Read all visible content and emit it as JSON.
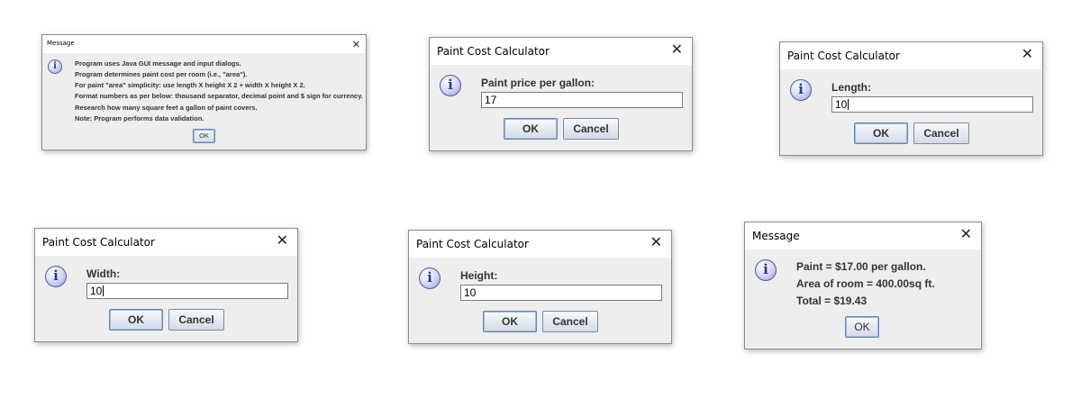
{
  "dialogs": {
    "intro": {
      "title": "Message",
      "close_glyph": "✕",
      "lines": [
        "Program uses Java GUI message and input dialogs.",
        "Program determines paint cost per room (i.e., \"area\").",
        "For paint \"area\" simplicity: use length X height X 2 + width X height X 2.",
        "Format numbers as per below: thousand separator, decimal point and $ sign for currency.",
        "Research how many square feet a gallon of paint covers.",
        "Note: Program performs data validation."
      ],
      "ok_label": "OK"
    },
    "price": {
      "title": "Paint Cost Calculator",
      "close_glyph": "✕",
      "prompt": "Paint price per gallon:",
      "value": "17",
      "ok_label": "OK",
      "cancel_label": "Cancel"
    },
    "length": {
      "title": "Paint Cost Calculator",
      "close_glyph": "✕",
      "prompt": "Length:",
      "value": "10",
      "ok_label": "OK",
      "cancel_label": "Cancel"
    },
    "width": {
      "title": "Paint Cost Calculator",
      "close_glyph": "✕",
      "prompt": "Width:",
      "value": "10",
      "ok_label": "OK",
      "cancel_label": "Cancel"
    },
    "height": {
      "title": "Paint Cost Calculator",
      "close_glyph": "✕",
      "prompt": "Height:",
      "value": "10",
      "ok_label": "OK",
      "cancel_label": "Cancel"
    },
    "result": {
      "title": "Message",
      "close_glyph": "✕",
      "lines": [
        "Paint = $17.00 per gallon.",
        "Area of room = 400.00sq ft.",
        "Total = $19.43"
      ],
      "ok_label": "OK"
    }
  },
  "icon_glyph": "i",
  "colors": {
    "dialog_bg": "#eeeeee",
    "titlebar_bg": "#ffffff",
    "button_border": "#7c8aa3",
    "icon_ring": "#4f5aa6"
  }
}
